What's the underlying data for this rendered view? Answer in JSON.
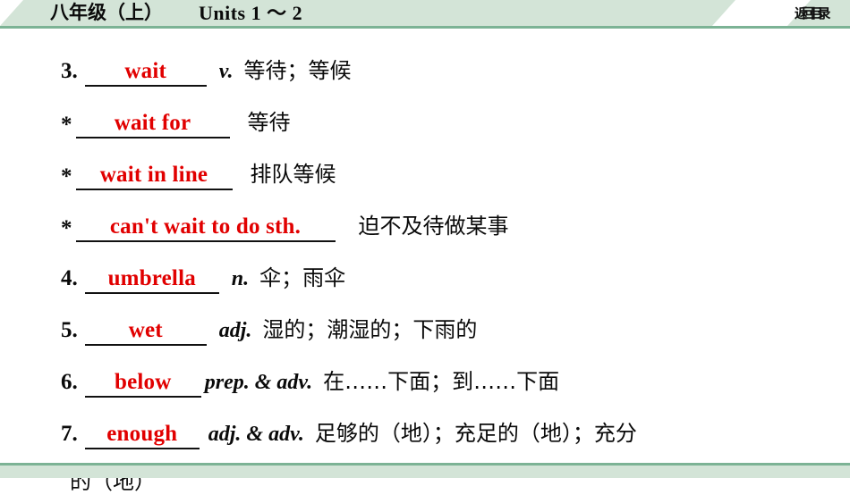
{
  "header": {
    "grade_label": "八年级（上）",
    "units_label": "Units 1 ～ 2",
    "back_button": "返回目录"
  },
  "colors": {
    "band": "#d3e4d7",
    "rule": "#7cb395",
    "answer_red": "#e10000",
    "text": "#0a0a0a"
  },
  "entries": [
    {
      "marker": "3.",
      "answer": "wait",
      "pos": "v.",
      "meaning": "等待；等候"
    },
    {
      "marker": "*",
      "answer": "wait for",
      "pos": "",
      "meaning": "等待"
    },
    {
      "marker": "*",
      "answer": "wait in line",
      "pos": "",
      "meaning": "排队等候"
    },
    {
      "marker": "*",
      "answer": "can't wait to do sth.",
      "pos": "",
      "meaning": "迫不及待做某事"
    },
    {
      "marker": "4.",
      "answer": "umbrella",
      "pos": "n.",
      "meaning": "伞；雨伞"
    },
    {
      "marker": "5.",
      "answer": "wet",
      "pos": "adj.",
      "meaning": "湿的；潮湿的；下雨的"
    },
    {
      "marker": "6.",
      "answer": "below",
      "pos": "prep. & adv.",
      "meaning": "在……下面；到……下面"
    },
    {
      "marker": "7.",
      "answer": "enough",
      "pos": "adj. & adv.",
      "meaning": "足够的（地）；充足的（地）；充分"
    }
  ],
  "overflow_line": "的（地）"
}
